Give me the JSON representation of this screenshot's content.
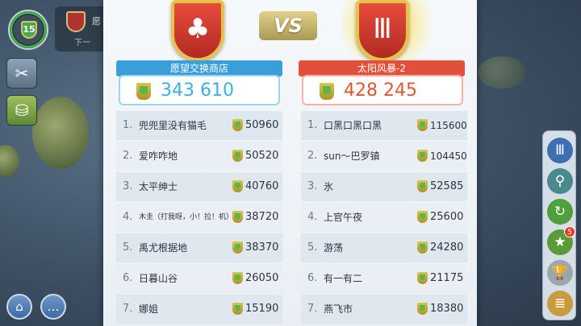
{
  "player": {
    "level": "15"
  },
  "notice": {
    "title": "愿",
    "subtitle": "下一",
    "crest_icon": "red-cross-crest"
  },
  "left_buttons": [
    {
      "icon": "tools-icon",
      "glyph": "✂"
    },
    {
      "icon": "shop-bag-icon",
      "glyph": "⛁"
    }
  ],
  "bottom_buttons": [
    {
      "icon": "home-icon",
      "glyph": "⌂"
    },
    {
      "icon": "chat-icon",
      "glyph": "…"
    }
  ],
  "right_toolbar": {
    "buttons": [
      {
        "icon": "bank-icon",
        "glyph": "Ⅲ",
        "color": "#3f6fb0"
      },
      {
        "icon": "magnifier-icon",
        "glyph": "⚲",
        "color": "#4a8a8c"
      },
      {
        "icon": "green-arrow-icon",
        "glyph": "↻",
        "color": "#4f9f3a"
      },
      {
        "icon": "star-icon",
        "glyph": "★",
        "color": "#5a9a3a",
        "badge": "5"
      },
      {
        "icon": "trophy-icon",
        "glyph": "🏆",
        "color": "#9aa5b0"
      },
      {
        "icon": "scroll-icon",
        "glyph": "≣",
        "color": "#c89b3e"
      }
    ]
  },
  "vs": {
    "label": "VS",
    "left_crest_glyph": "♣",
    "right_crest_glyph": "Ⅲ",
    "left_team": {
      "name": "愿望交换商店",
      "score": "343 610",
      "color": "#3a9fd8",
      "score_color": "#3ab0e0",
      "members": [
        {
          "rank": "1.",
          "name": "兜兜里没有猫毛",
          "score": "50960"
        },
        {
          "rank": "2.",
          "name": "爱咋咋地",
          "score": "50520"
        },
        {
          "rank": "3.",
          "name": "太平绅士",
          "score": "40760"
        },
        {
          "rank": "4.",
          "name": "木圭（打我呀，小！拉！机）",
          "score": "38720"
        },
        {
          "rank": "5.",
          "name": "禹尤根据地",
          "score": "38370"
        },
        {
          "rank": "6.",
          "name": "日暮山谷",
          "score": "26050"
        },
        {
          "rank": "7.",
          "name": "娜姐",
          "score": "15190"
        }
      ]
    },
    "right_team": {
      "name": "太阳风暴-2",
      "score": "428 245",
      "color": "#e2503b",
      "score_color": "#e0562f",
      "members": [
        {
          "rank": "1.",
          "name": "口黑口黑口黑",
          "score": "115600"
        },
        {
          "rank": "2.",
          "name": "sun～巴罗镇",
          "score": "104450"
        },
        {
          "rank": "3.",
          "name": "氷",
          "score": "52585"
        },
        {
          "rank": "4.",
          "name": "上官午夜",
          "score": "25600"
        },
        {
          "rank": "5.",
          "name": "游荡",
          "score": "24280"
        },
        {
          "rank": "6.",
          "name": "有一有二",
          "score": "21175"
        },
        {
          "rank": "7.",
          "name": "燕飞市",
          "score": "18380"
        }
      ]
    }
  }
}
